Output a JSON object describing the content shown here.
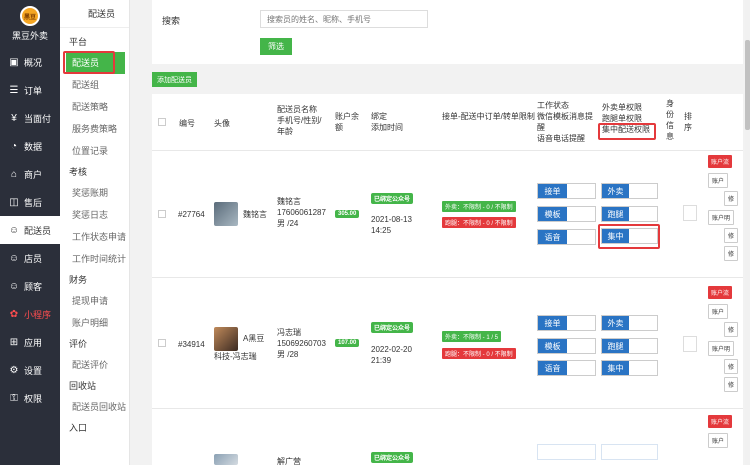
{
  "brand": {
    "logo_text": "黑豆",
    "name": "黑豆外卖"
  },
  "nav": [
    {
      "label": "概况",
      "icon": "dashboard-icon",
      "glyph": "▣"
    },
    {
      "label": "订单",
      "icon": "order-icon",
      "glyph": "☰"
    },
    {
      "label": "当面付",
      "icon": "pay-icon",
      "glyph": "¥"
    },
    {
      "label": "数据",
      "icon": "chart-icon",
      "glyph": "◔"
    },
    {
      "label": "商户",
      "icon": "store-icon",
      "glyph": "⌂"
    },
    {
      "label": "售后",
      "icon": "aftersale-icon",
      "glyph": "◫"
    },
    {
      "label": "配送员",
      "icon": "user-icon",
      "glyph": "☺"
    },
    {
      "label": "店员",
      "icon": "staff-icon",
      "glyph": "☺"
    },
    {
      "label": "顾客",
      "icon": "customer-icon",
      "glyph": "☺"
    },
    {
      "label": "小程序",
      "icon": "miniprogram-icon",
      "glyph": "✿"
    },
    {
      "label": "应用",
      "icon": "apps-icon",
      "glyph": "⊞"
    },
    {
      "label": "设置",
      "icon": "gear-icon",
      "glyph": "⚙"
    },
    {
      "label": "权限",
      "icon": "permission-icon",
      "glyph": "⚿"
    }
  ],
  "subnav": {
    "title": "配送员",
    "sections": [
      {
        "group": "平台",
        "links": [
          "配送员",
          "配送组",
          "配送策略",
          "服务费策略",
          "位置记录"
        ]
      },
      {
        "group": "考核",
        "links": [
          "奖惩账期",
          "奖惩日志",
          "工作状态申请",
          "工作时间统计"
        ]
      },
      {
        "group": "财务",
        "links": [
          "提现申请",
          "账户明细"
        ]
      },
      {
        "group": "评价",
        "links": [
          "配送评价"
        ]
      },
      {
        "group": "回收站",
        "links": [
          "配送员回收站"
        ]
      },
      {
        "group": "入口",
        "links": []
      }
    ]
  },
  "filter": {
    "label": "搜索",
    "placeholder": "搜索员的姓名、昵称、手机号",
    "button": "筛选"
  },
  "add_button": "添加配送员",
  "headers": {
    "id": "编号",
    "avatar": "头像",
    "info": [
      "配送员名称",
      "手机号/性别/",
      "年龄"
    ],
    "balance": [
      "账户余",
      "额"
    ],
    "bind": [
      "绑定",
      "添加时间"
    ],
    "limit": "接单-配送中订单/转单限制",
    "work": [
      "工作状态",
      "微信模板消息提",
      "醒",
      "语音电话提醒"
    ],
    "perm": [
      "外卖单权限",
      "跑腿单权限",
      "集中配送权限"
    ],
    "identity": [
      "身",
      "份",
      "信",
      "息"
    ],
    "sort": [
      "排",
      "序"
    ]
  },
  "rows": [
    {
      "id": "#27764",
      "name": "魏铭言",
      "avatar_name": "魏铭言",
      "phone": "17606061287",
      "gender_age": "男 /24",
      "balance": "305.00",
      "bind_status": "已绑定公众号",
      "date": "2021-08-13",
      "time": "14:25",
      "limit_waimai": "外卖：不限制 - 0 / 不限制",
      "limit_paotui": "跑腿：不限制 - 0 / 不限制",
      "work": [
        "接单",
        "模板",
        "语音"
      ],
      "perm": [
        "外卖",
        "跑腿",
        "集中"
      ],
      "actions": [
        "账户流",
        "账户",
        "修",
        "账户明",
        "修",
        "修"
      ]
    },
    {
      "id": "#34914",
      "name": "冯志瑞",
      "avatar_name": "A黑豆",
      "avatar_sub": "科技-冯志瑞",
      "phone": "15069260703",
      "gender_age": "男 /28",
      "balance": "107.00",
      "bind_status": "已绑定公众号",
      "date": "2022-02-20",
      "time": "21:39",
      "limit_waimai": "外卖：不限制 - 1 / 5",
      "limit_paotui": "跑腿：不限制 - 0 / 不限制",
      "work": [
        "接单",
        "模板",
        "语音"
      ],
      "perm": [
        "外卖",
        "跑腿",
        "集中"
      ],
      "actions": [
        "账户流",
        "账户",
        "修",
        "账户明",
        "修",
        "修"
      ]
    },
    {
      "id": "",
      "name": "解广营",
      "bind_status": "已绑定公众号",
      "actions": [
        "账户流",
        "账户"
      ]
    }
  ],
  "colors": {
    "green": "#44b549",
    "blue": "#2a74c4",
    "red": "#e4393c",
    "dark": "#2b2f3a"
  }
}
